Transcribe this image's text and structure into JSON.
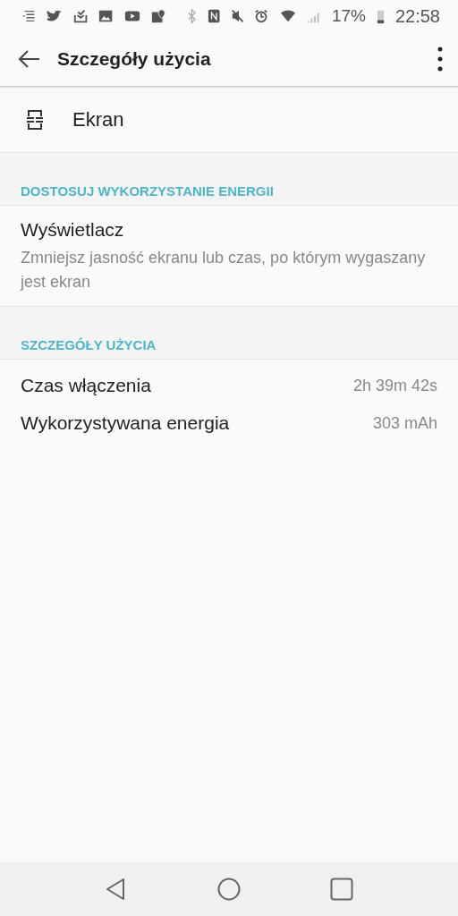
{
  "status_bar": {
    "battery": "17%",
    "time": "22:58"
  },
  "toolbar": {
    "title": "Szczegóły użycia"
  },
  "app": {
    "name": "Ekran"
  },
  "sections": [
    {
      "header": "DOSTOSUJ WYKORZYSTANIE ENERGII",
      "items": [
        {
          "kind": "option",
          "title": "Wyświetlacz",
          "summary": "Zmniejsz jasność ekranu lub czas, po którym wygaszany jest ekran"
        }
      ]
    },
    {
      "header": "SZCZEGÓŁY UŻYCIA",
      "items": [
        {
          "kind": "stat",
          "label": "Czas włączenia",
          "value": "2h 39m 42s"
        },
        {
          "kind": "stat",
          "label": "Wykorzystywana energia",
          "value": "303 mAh"
        }
      ]
    }
  ]
}
